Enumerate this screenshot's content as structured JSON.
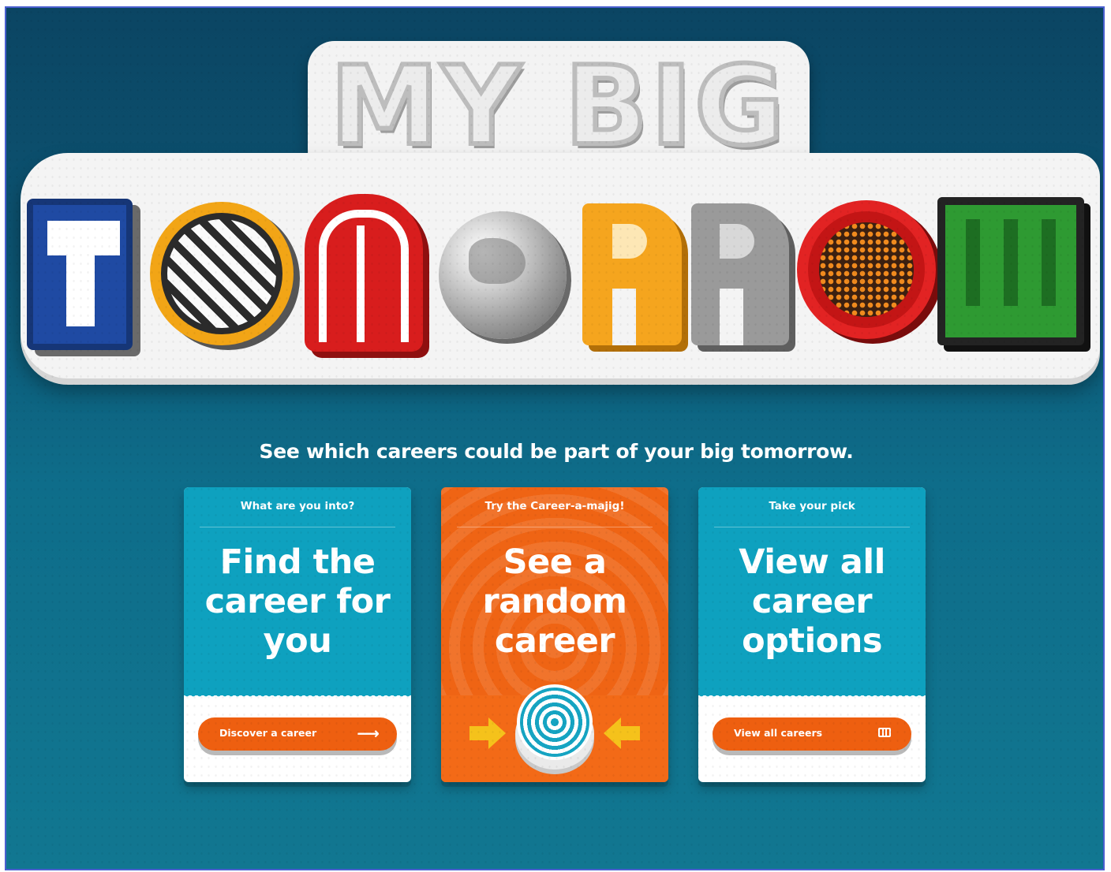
{
  "logo": {
    "line1": "MY BIG",
    "line2": "TOMORROW",
    "colors": {
      "T": "#1f4aa3",
      "O1": "#f2a516",
      "M": "#d81d1d",
      "R1": "#f5a51e",
      "R2": "#9a9a9a",
      "O2": "#e22323",
      "W": "#2e9a32"
    }
  },
  "tagline": "See which careers could be part of your big tomorrow.",
  "cards": [
    {
      "kicker": "What are you into?",
      "headline": "Find the career for you",
      "button_label": "Discover a career",
      "button_icon": "arrow-right-icon",
      "color": "#0ea1bf"
    },
    {
      "kicker": "Try the Career-a-majig!",
      "headline": "See a random career",
      "button_icon": "spiral-button-icon",
      "color": "#ef6414"
    },
    {
      "kicker": "Take your pick",
      "headline": "View all career options",
      "button_label": "View all careers",
      "button_icon": "grid-icon",
      "color": "#0ea1bf"
    }
  ],
  "accent_button_color": "#ee5f10"
}
